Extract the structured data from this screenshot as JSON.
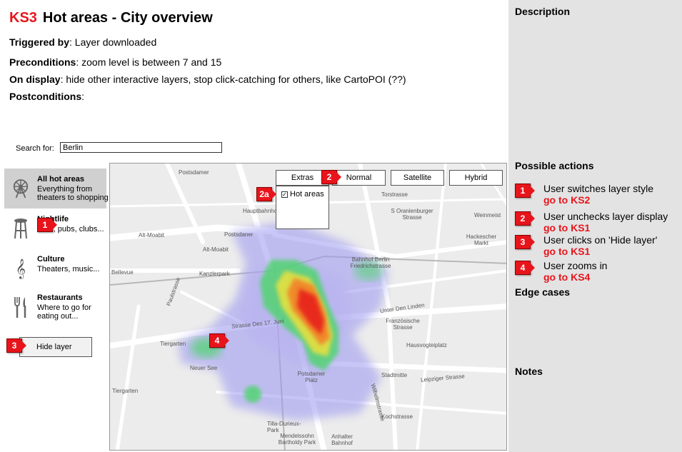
{
  "header": {
    "code": "KS3",
    "title": "Hot areas - City overview",
    "triggered_label": "Triggered by",
    "triggered_value": ": Layer downloaded",
    "pre_label": "Preconditions",
    "pre_value": ": zoom level is between 7 and 15",
    "display_label": "On display",
    "display_value": ": hide other interactive layers, stop click-catching for others, like CartoPOI (??)",
    "post_label": "Postconditions",
    "post_value": ":"
  },
  "search": {
    "label": "Search for:",
    "value": "Berlin"
  },
  "categories": [
    {
      "name": "All hot areas",
      "desc": "Everything from theaters to shopping",
      "icon": "ferris-wheel-icon"
    },
    {
      "name": "Nightlife",
      "desc": "Bars, pubs, clubs...",
      "icon": "bar-stool-icon"
    },
    {
      "name": "Culture",
      "desc": "Theaters, music...",
      "icon": "treble-clef-icon"
    },
    {
      "name": "Restaurants",
      "desc": "Where to go for eating out...",
      "icon": "fork-knife-icon"
    }
  ],
  "hide_layer": {
    "label": "Hide layer"
  },
  "map": {
    "buttons": {
      "extras": "Extras",
      "normal": "Normal",
      "satellite": "Satellite",
      "hybrid": "Hybrid"
    },
    "extras_option": "Hot areas",
    "labels": [
      "Postsdaner",
      "Alt-Moabit",
      "Alt-Moabit",
      "Bellevue",
      "Kanzlerpark",
      "Paulstrasse",
      "Torstrasse",
      "S Oranienburger Strasse",
      "Weinmeist",
      "Hackescher Markt",
      "Bahnhof Berlin Friedrichstrasse",
      "Unter Den Linden",
      "Französische Strasse",
      "Hausvogteiplatz",
      "Stadtmitte",
      "Leipziger Strasse",
      "Strasse Des 17. Juni",
      "Tiergarten",
      "Neuer See",
      "Potsdamer Platz",
      "Kochstrasse",
      "Tilla-Durieux-Park",
      "Mendelssohn Bartholdy Park",
      "Anhalter Bahnhof",
      "Wilhelmstrasse",
      "Hauptbahnhof",
      "Postsdamer"
    ]
  },
  "markers": [
    "1",
    "2",
    "2a",
    "3",
    "4"
  ],
  "panel": {
    "description": "Description",
    "possible_actions": "Possible actions",
    "actions": [
      {
        "num": "1",
        "text": "User switches layer style",
        "go": "go to KS2"
      },
      {
        "num": "2",
        "text": "User unchecks layer display",
        "go": "go to KS1"
      },
      {
        "num": "3",
        "text": "User clicks on 'Hide layer'",
        "go": "go to KS1"
      },
      {
        "num": "4",
        "text": "User zooms in",
        "go": "go to KS4"
      }
    ],
    "edge_cases": "Edge cases",
    "notes": "Notes"
  },
  "colors": {
    "accent_red": "#e8141b",
    "panel_bg": "#e3e3e3",
    "active_item_bg": "#d0d0d0"
  }
}
